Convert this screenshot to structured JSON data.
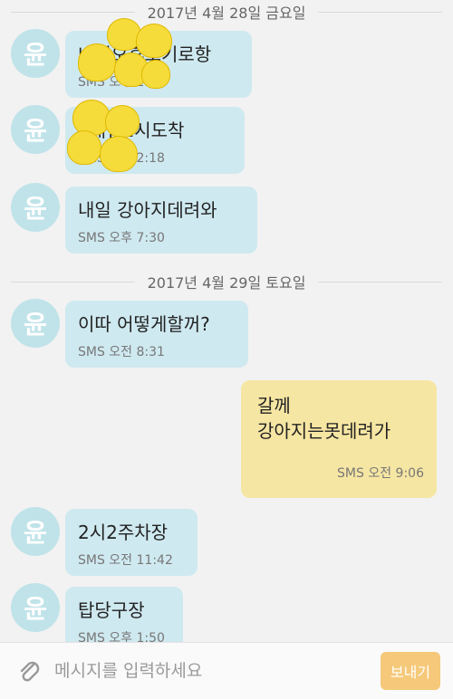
{
  "dates": [
    "2017년 4월 28일 금요일",
    "2017년 4월 29일 토요일"
  ],
  "contact_initial": "윤",
  "messages": [
    {
      "text": "내일오후오기로항",
      "meta": "SMS 오후 2:07"
    },
    {
      "text": "2내일2시도착",
      "meta": "SMS 오후 2:18"
    },
    {
      "text": "내일 강아지데려와",
      "meta": "SMS 오후 7:30"
    },
    {
      "text": "이따 어떻게할꺼?",
      "meta": "SMS 오전 8:31"
    },
    {
      "text": "갈께\n강아지는못데려가",
      "meta": "SMS 오전 9:06"
    },
    {
      "text": "2시2주차장",
      "meta": "SMS 오전 11:42"
    },
    {
      "text": "탑당구장",
      "meta": "SMS 오후 1:50"
    }
  ],
  "composer": {
    "placeholder": "메시지를 입력하세요",
    "send_label": "보내기"
  },
  "icons": {
    "attach": "paperclip-icon",
    "sticker": "emoji-sticker"
  },
  "colors": {
    "incoming_bubble": "#cfe9f0",
    "outgoing_bubble": "#f6e6a3",
    "avatar": "#bfe3e9",
    "send_button": "#f6c879"
  }
}
